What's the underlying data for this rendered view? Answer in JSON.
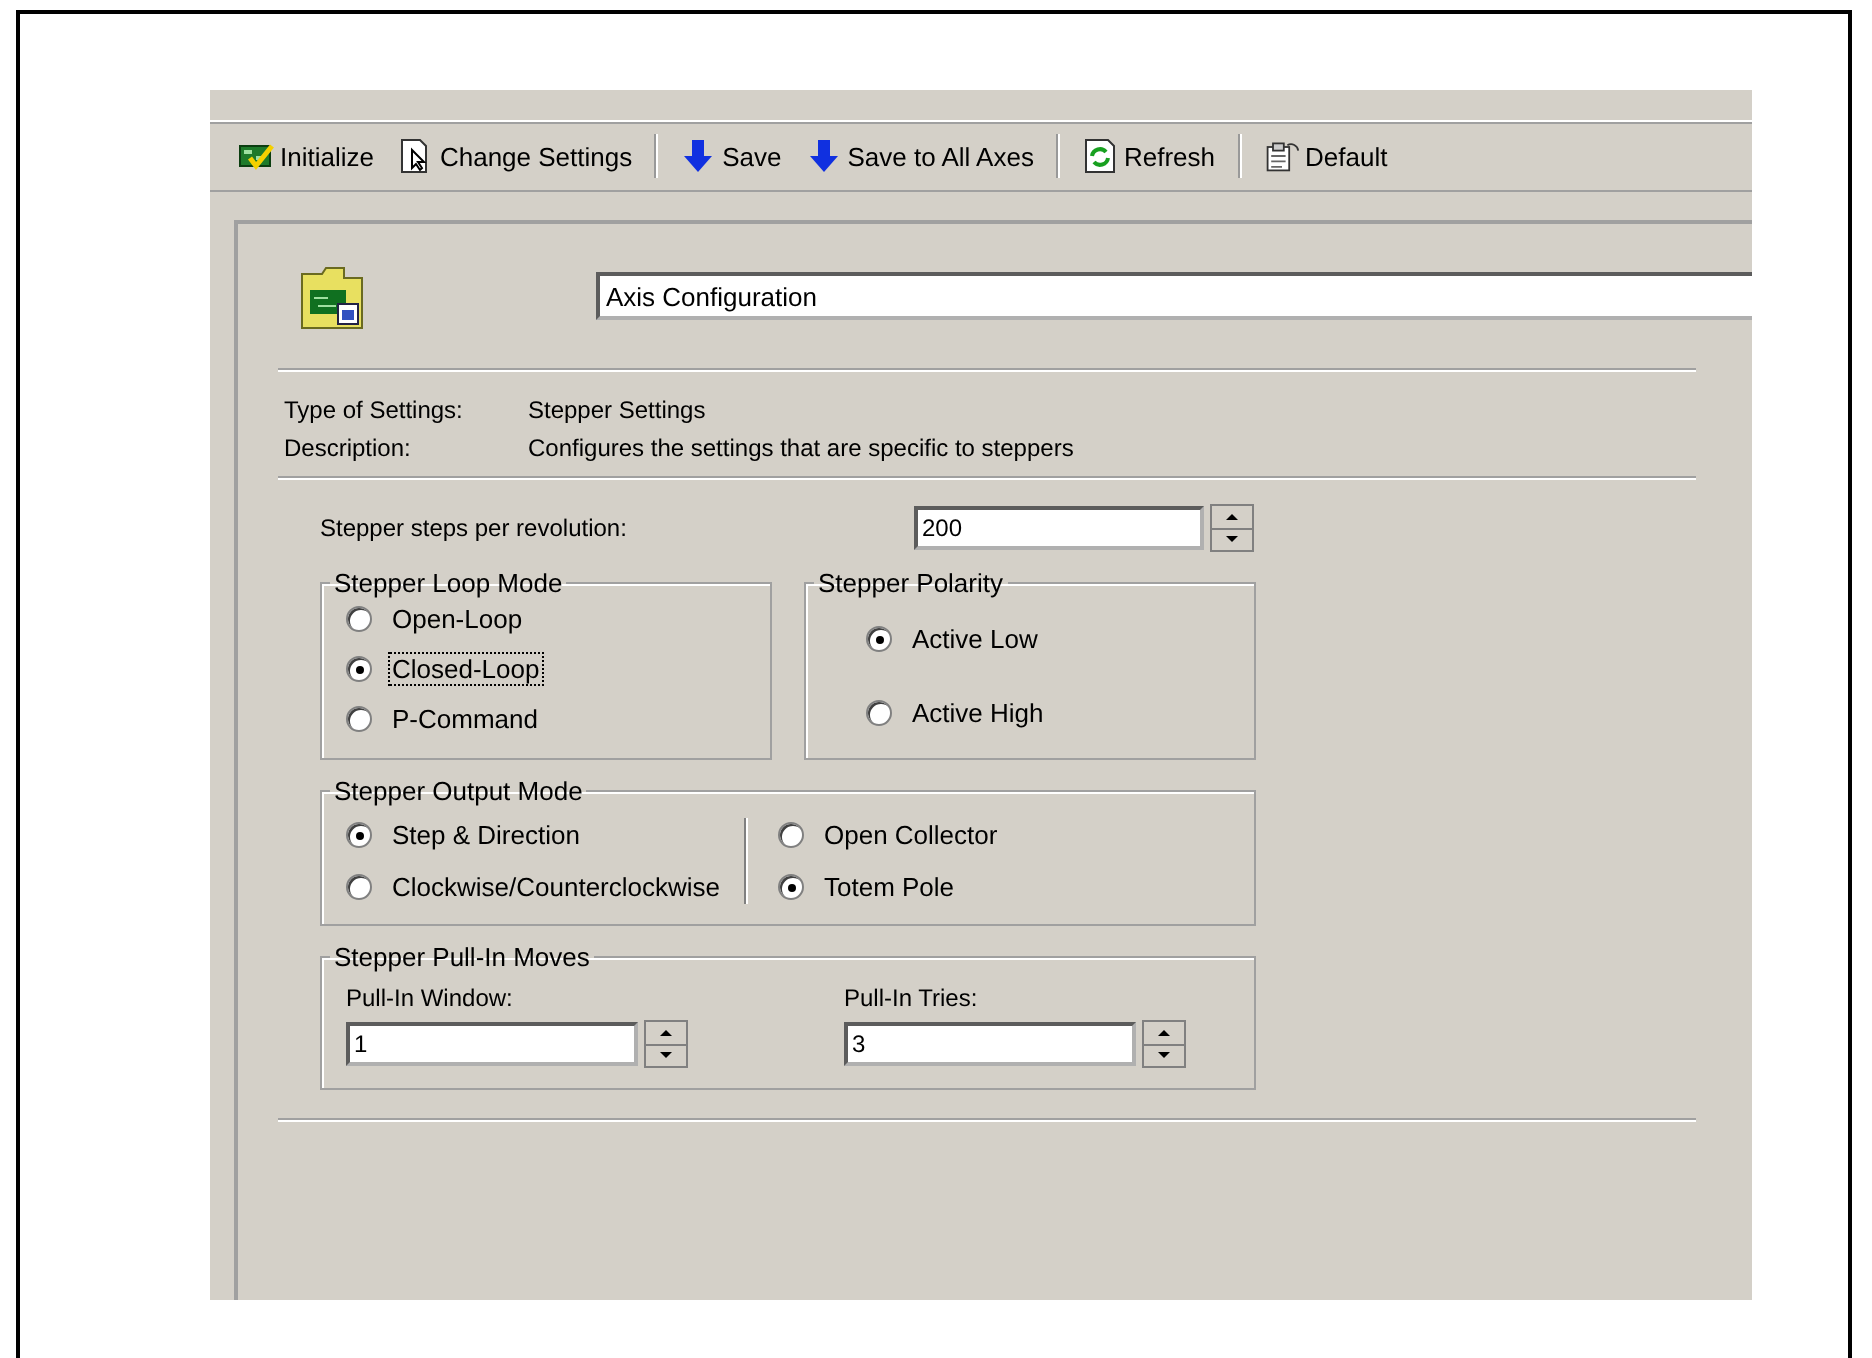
{
  "toolbar": [
    {
      "kind": "initialize",
      "label": "Initialize"
    },
    {
      "kind": "change",
      "label": "Change Settings"
    },
    {
      "kind": "separator"
    },
    {
      "kind": "save",
      "label": "Save"
    },
    {
      "kind": "save",
      "label": "Save to All Axes"
    },
    {
      "kind": "separator"
    },
    {
      "kind": "refresh",
      "label": "Refresh"
    },
    {
      "kind": "separator"
    },
    {
      "kind": "defaults",
      "label": "Default"
    }
  ],
  "name_field": {
    "value": "Axis Configuration"
  },
  "info": [
    {
      "label": "Type of Settings:",
      "value": "Stepper Settings"
    },
    {
      "label": "Description:",
      "value": "Configures the settings that are specific to steppers"
    }
  ],
  "steps": {
    "label": "Stepper steps per revolution:",
    "value": "200"
  },
  "loop_mode": {
    "title": "Stepper Loop Mode",
    "options": [
      {
        "label": "Open-Loop",
        "selected": false,
        "focused": false
      },
      {
        "label": "Closed-Loop",
        "selected": true,
        "focused": true
      },
      {
        "label": "P-Command",
        "selected": false,
        "focused": false
      }
    ]
  },
  "polarity": {
    "title": "Stepper Polarity",
    "options": [
      {
        "label": "Active Low",
        "selected": true
      },
      {
        "label": "Active High",
        "selected": false
      }
    ]
  },
  "output_mode": {
    "title": "Stepper Output Mode",
    "columns": [
      [
        {
          "label": "Step & Direction",
          "selected": true
        },
        {
          "label": "Clockwise/Counterclockwise",
          "selected": false
        }
      ],
      [
        {
          "label": "Open Collector",
          "selected": false
        },
        {
          "label": "Totem Pole",
          "selected": true
        }
      ]
    ]
  },
  "pull_in": {
    "title": "Stepper Pull-In Moves",
    "fields": [
      {
        "label": "Pull-In Window:",
        "value": "1"
      },
      {
        "label": "Pull-In Tries:",
        "value": "3"
      }
    ]
  }
}
